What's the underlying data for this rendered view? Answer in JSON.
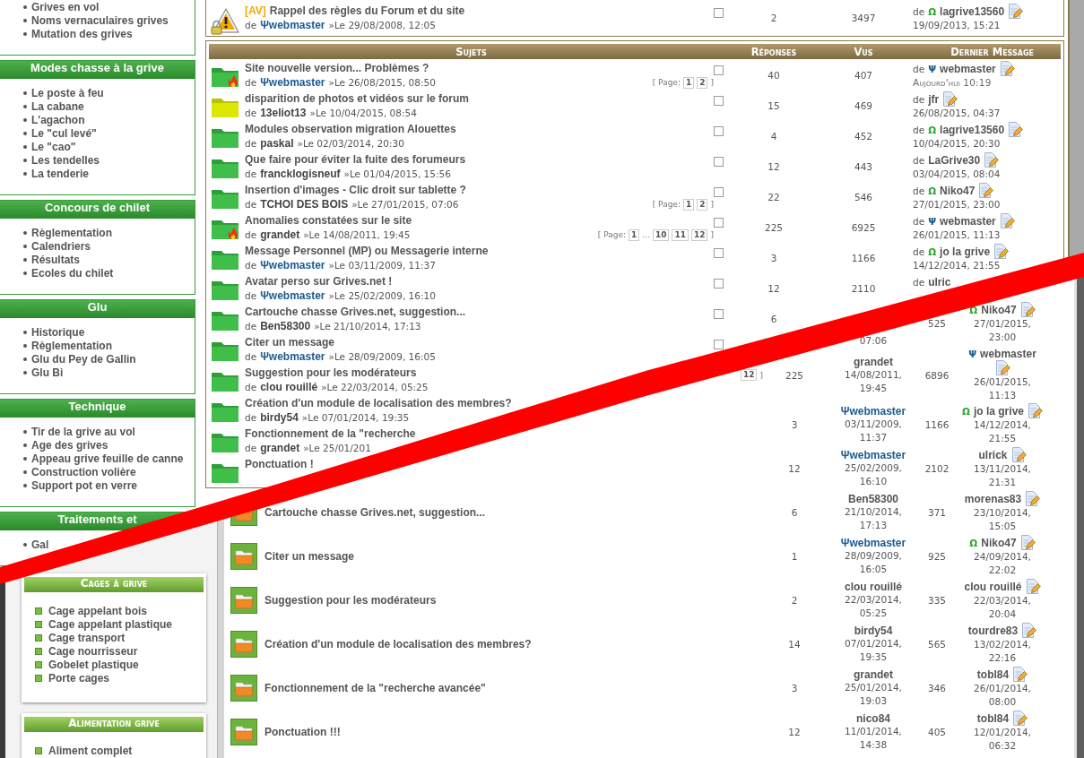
{
  "old": {
    "sidebar": [
      {
        "items": [
          "Grives en vol",
          "Noms vernaculaires grives",
          "Mutation des grives"
        ]
      },
      {
        "title": "Modes chasse à la grive",
        "items": [
          "Le poste à feu",
          "La cabane",
          "L'agachon",
          "Le \"cul levé\"",
          "Le \"cao\"",
          "Les tendelles",
          "La tenderie"
        ]
      },
      {
        "title": "Concours de chilet",
        "items": [
          "Règlementation",
          "Calendriers",
          "Résultats",
          "Ecoles du chilet"
        ]
      },
      {
        "title": "Glu",
        "items": [
          "Historique",
          "Règlementation",
          "Glu du Pey de Gallin",
          "Glu Bi"
        ]
      },
      {
        "title": "Technique",
        "items": [
          "Tir de la grive au vol",
          "Age des grives",
          "Appeau grive feuille de canne",
          "Construction volière",
          "Support pot en verre"
        ]
      },
      {
        "title": "Traitements et",
        "items": [
          "Gal"
        ]
      }
    ],
    "forums": [
      {
        "topics": [
          {
            "kind": "announce",
            "prefix": "[AV]",
            "title": "Rappel des règles du Forum et du site",
            "by": "de",
            "author": {
              "symbol": "Ψ",
              "name": "webmaster",
              "kind": "admin"
            },
            "date": "»Le 29/08/2008, 12:05",
            "checked": false,
            "replies": "2",
            "views": "3497",
            "last": {
              "by": "de",
              "symbol": "Ω",
              "name": "lagrive13560",
              "kind": "moderator",
              "edit": true,
              "date": "19/09/2013, 15:21",
              "today": false
            }
          }
        ]
      },
      {
        "columns": [
          "Sujets",
          "Réponses",
          "Vus",
          "Dernier Message"
        ],
        "topics": [
          {
            "kind": "hot",
            "title": "Site nouvelle version... Problèmes ?",
            "by": "de",
            "author": {
              "symbol": "Ψ",
              "name": "webmaster",
              "kind": "admin"
            },
            "date": "»Le 26/08/2015, 08:50",
            "pages": {
              "label": "[ Page:",
              "items": [
                {
                  "text": "1",
                  "kind": "page"
                },
                {
                  "text": "2",
                  "kind": "page"
                }
              ],
              "end": "]"
            },
            "checked": false,
            "replies": "40",
            "views": "407",
            "last": {
              "by": "de",
              "symbol": "Ψ",
              "name": "webmaster",
              "kind": "admin",
              "edit": true,
              "date": "Aujourd'hui 10:19",
              "today": true
            }
          },
          {
            "kind": "unread",
            "title": "disparition de photos et vidéos sur le forum",
            "by": "de",
            "author": {
              "name": "13eliot13",
              "kind": "member"
            },
            "date": "»Le 10/04/2015, 08:54",
            "checked": false,
            "replies": "15",
            "views": "469",
            "last": {
              "by": "de",
              "name": "jfr",
              "edit": true,
              "date": "26/08/2015, 04:37",
              "today": false
            }
          },
          {
            "kind": "folder",
            "title": "Modules observation migration Alouettes",
            "by": "de",
            "author": {
              "name": "paskal",
              "kind": "member"
            },
            "date": "»Le 02/03/2014, 20:30",
            "checked": false,
            "replies": "4",
            "views": "452",
            "last": {
              "by": "de",
              "symbol": "Ω",
              "name": "lagrive13560",
              "kind": "moderator",
              "edit": true,
              "date": "10/04/2015, 20:30",
              "today": false
            }
          },
          {
            "kind": "folder",
            "title": "Que faire pour éviter la fuite des forumeurs",
            "by": "de",
            "author": {
              "name": "francklogisneuf",
              "kind": "member"
            },
            "date": "»Le 01/04/2015, 15:56",
            "checked": false,
            "replies": "12",
            "views": "443",
            "last": {
              "by": "de",
              "name": "LaGrive30",
              "edit": true,
              "date": "03/04/2015, 08:04",
              "today": false
            }
          },
          {
            "kind": "folder",
            "title": "Insertion d'images - Clic droit sur tablette ?",
            "by": "de",
            "author": {
              "name": "TCHOI DES BOIS",
              "kind": "member"
            },
            "date": "»Le 27/01/2015, 07:06",
            "pages": {
              "label": "[ Page:",
              "items": [
                {
                  "text": "1",
                  "kind": "page"
                },
                {
                  "text": "2",
                  "kind": "page"
                }
              ],
              "end": "]"
            },
            "checked": false,
            "replies": "22",
            "views": "546",
            "last": {
              "by": "de",
              "symbol": "Ω",
              "name": "Niko47",
              "kind": "moderator",
              "edit": true,
              "date": "27/01/2015, 23:00",
              "today": false
            }
          },
          {
            "kind": "hot",
            "title": "Anomalies constatées sur le site",
            "by": "de",
            "author": {
              "name": "grandet",
              "kind": "member"
            },
            "date": "»Le 14/08/2011, 19:45",
            "pages": {
              "label": "[ Page:",
              "items": [
                {
                  "text": "1",
                  "kind": "page"
                },
                {
                  "text": "...",
                  "kind": "gap"
                },
                {
                  "text": "10",
                  "kind": "page"
                },
                {
                  "text": "11",
                  "kind": "page"
                },
                {
                  "text": "12",
                  "kind": "page"
                }
              ],
              "end": "]"
            },
            "checked": false,
            "replies": "225",
            "views": "6925",
            "last": {
              "by": "de",
              "symbol": "Ψ",
              "name": "webmaster",
              "kind": "admin",
              "edit": true,
              "date": "26/01/2015, 11:13",
              "today": false
            }
          },
          {
            "kind": "folder",
            "title": "Message Personnel (MP) ou Messagerie interne",
            "by": "de",
            "author": {
              "symbol": "Ψ",
              "name": "webmaster",
              "kind": "admin"
            },
            "date": "»Le 03/11/2009, 11:37",
            "checked": false,
            "replies": "3",
            "views": "1166",
            "last": {
              "by": "de",
              "symbol": "Ω",
              "name": "jo la grive",
              "kind": "moderator",
              "edit": true,
              "date": "14/12/2014, 21:55",
              "today": false
            }
          },
          {
            "kind": "folder",
            "title": "Avatar perso sur Grives.net !",
            "by": "de",
            "author": {
              "symbol": "Ψ",
              "name": "webmaster",
              "kind": "admin"
            },
            "date": "»Le 25/02/2009, 16:10",
            "checked": false,
            "replies": "12",
            "views": "2110",
            "last": {
              "by": "de",
              "name": "ulric",
              "edit": false
            }
          },
          {
            "kind": "folder",
            "title": "Cartouche chasse Grives.net, suggestion...",
            "by": "de",
            "author": {
              "name": "Ben58300",
              "kind": "member"
            },
            "date": "»Le 21/10/2014, 17:13",
            "checked": false,
            "replies": "6"
          },
          {
            "kind": "folder",
            "title": "Citer un message",
            "by": "de",
            "author": {
              "symbol": "Ψ",
              "name": "webmaster",
              "kind": "admin"
            },
            "date": "»Le 28/09/2009, 16:05",
            "checked": false
          },
          {
            "kind": "folder",
            "title": "Suggestion pour les modérateurs",
            "by": "de",
            "author": {
              "name": "clou rouillé",
              "kind": "member"
            },
            "date": "»Le 22/03/2014, 05:25"
          },
          {
            "kind": "folder",
            "title": "Création d'un module de localisation des membres?",
            "by": "de",
            "author": {
              "name": "birdy54",
              "kind": "member"
            },
            "date": "»Le 07/01/2014, 19:35"
          },
          {
            "kind": "folder",
            "title": "Fonctionnement de la \"recherche",
            "by": "de",
            "author": {
              "name": "grandet",
              "kind": "member"
            },
            "date": "»Le 25/01/201"
          },
          {
            "kind": "folder",
            "title": "Ponctuation !"
          }
        ]
      }
    ]
  },
  "new": {
    "sidebar": [
      {
        "title": "Cages à grive",
        "items": [
          "Cage appelant bois",
          "Cage appelant plastique",
          "Cage transport",
          "Cage nourrisseur",
          "Gobelet plastique",
          "Porte cages"
        ]
      },
      {
        "title": "Alimentation grive",
        "items": [
          "Aliment complet"
        ]
      }
    ],
    "topics": [
      {
        "views": "525",
        "date": "07:06",
        "last": {
          "symbol": "Ω",
          "name": "Niko47",
          "kind": "moderator",
          "edit": true,
          "date": "27/01/2015, 23:00"
        }
      },
      {
        "pages": {
          "items": [
            {
              "text": "12",
              "kind": "page"
            }
          ],
          "end": "]"
        },
        "replies": "225",
        "author": {
          "name": "grandet",
          "kind": "member"
        },
        "date": "14/08/2011, 19:45",
        "views": "6896",
        "last": {
          "symbol": "Ψ",
          "name": "webmaster",
          "kind": "admin",
          "edit": true,
          "date": "26/01/2015, 11:13"
        }
      },
      {
        "replies": "3",
        "author": {
          "symbol": "Ψ",
          "name": "webmaster",
          "kind": "admin"
        },
        "date": "03/11/2009, 11:37",
        "views": "1166",
        "last": {
          "symbol": "Ω",
          "name": "jo la grive",
          "kind": "moderator",
          "edit": true,
          "date": "14/12/2014, 21:55"
        }
      },
      {
        "replies": "12",
        "author": {
          "symbol": "Ψ",
          "name": "webmaster",
          "kind": "admin"
        },
        "date": "25/02/2009, 16:10",
        "views": "2102",
        "last": {
          "name": "ulrick",
          "edit": true,
          "date": "13/11/2014, 21:31"
        }
      },
      {
        "kind": "folder",
        "title": "Cartouche chasse Grives.net, suggestion...",
        "replies": "6",
        "author": {
          "name": "Ben58300",
          "kind": "member"
        },
        "date": "21/10/2014, 17:13",
        "views": "371",
        "last": {
          "name": "morenas83",
          "edit": true,
          "date": "23/10/2014, 15:05"
        }
      },
      {
        "kind": "folder",
        "title": "Citer un message",
        "replies": "1",
        "author": {
          "symbol": "Ψ",
          "name": "webmaster",
          "kind": "admin"
        },
        "date": "28/09/2009, 16:05",
        "views": "925",
        "last": {
          "symbol": "Ω",
          "name": "Niko47",
          "kind": "moderator",
          "edit": true,
          "date": "24/09/2014, 22:02"
        }
      },
      {
        "kind": "folder",
        "title": "Suggestion pour les modérateurs",
        "replies": "2",
        "author": {
          "name": "clou rouillé",
          "kind": "member"
        },
        "date": "22/03/2014, 05:25",
        "views": "335",
        "last": {
          "name": "clou rouillé",
          "edit": true,
          "date": "22/03/2014, 20:04"
        }
      },
      {
        "kind": "folder",
        "title": "Création d'un module de localisation des membres?",
        "replies": "14",
        "author": {
          "name": "birdy54",
          "kind": "member"
        },
        "date": "07/01/2014, 19:35",
        "views": "565",
        "last": {
          "name": "tourdre83",
          "edit": true,
          "date": "13/02/2014, 22:16"
        }
      },
      {
        "kind": "folder",
        "title": "Fonctionnement de la \"recherche avancée\"",
        "replies": "3",
        "author": {
          "name": "grandet",
          "kind": "member"
        },
        "date": "25/01/2014, 19:03",
        "views": "346",
        "last": {
          "name": "tobl84",
          "edit": true,
          "date": "26/01/2014, 08:00"
        }
      },
      {
        "kind": "folder",
        "title": "Ponctuation !!!",
        "replies": "12",
        "author": {
          "name": "nico84",
          "kind": "member"
        },
        "date": "11/01/2014, 14:38",
        "views": "405",
        "last": {
          "name": "tobl84",
          "edit": true,
          "date": "12/01/2014, 06:32"
        }
      }
    ]
  }
}
